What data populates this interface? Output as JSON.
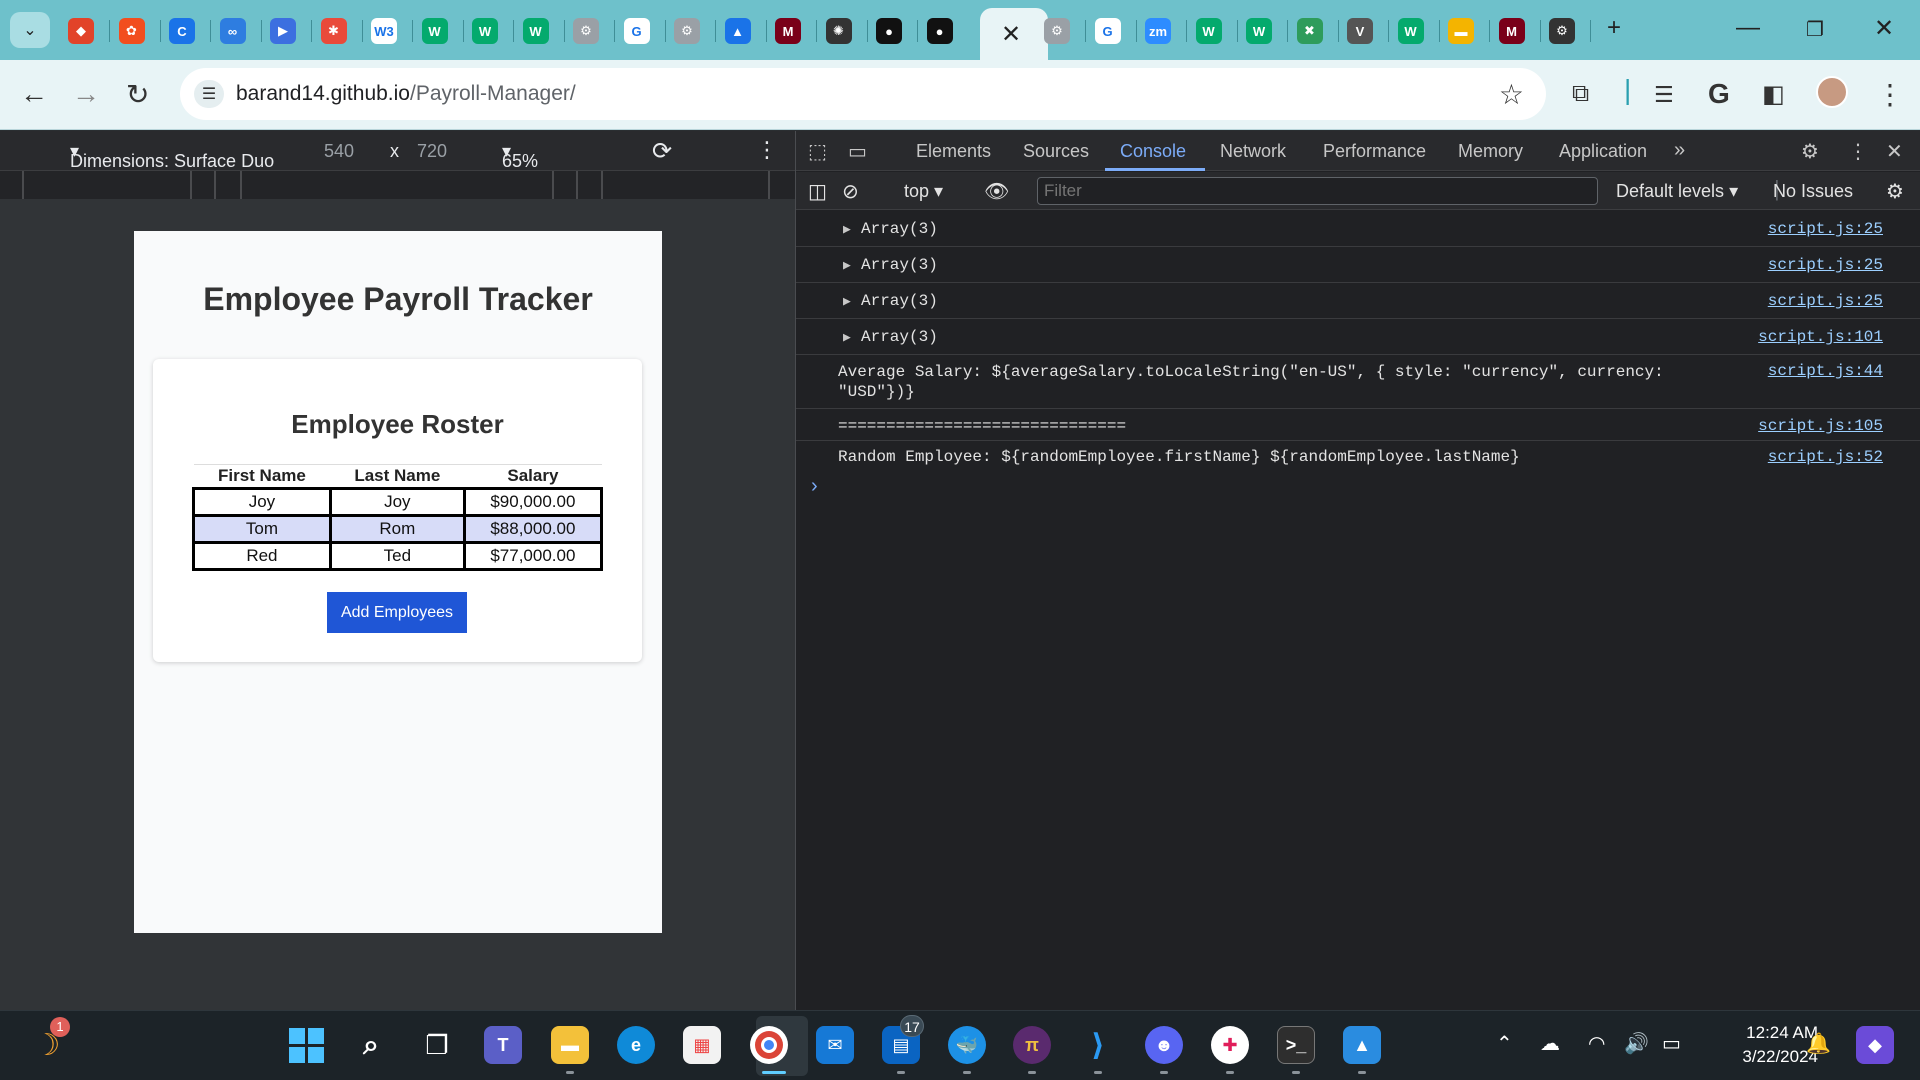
{
  "browser": {
    "tab_icons": [
      {
        "icon": "gitlab-icon",
        "color": "#e24329",
        "glyph": "◆"
      },
      {
        "icon": "figma-icon",
        "color": "#f24e1e",
        "glyph": "✿"
      },
      {
        "icon": "copyleaks-icon",
        "color": "#1a73e8",
        "glyph": "C"
      },
      {
        "icon": "loop-icon",
        "color": "#2e7de0",
        "glyph": "∞"
      },
      {
        "icon": "powerautomate-icon",
        "color": "#3c6fe0",
        "glyph": "▶"
      },
      {
        "icon": "asterisk-icon",
        "color": "#e94a3a",
        "glyph": "✱"
      },
      {
        "icon": "w3schools-icon",
        "color": "#ffffff",
        "glyph": "W3"
      },
      {
        "icon": "w-icon",
        "color": "#04aa6d",
        "glyph": "W"
      },
      {
        "icon": "w-icon",
        "color": "#04aa6d",
        "glyph": "W"
      },
      {
        "icon": "w-icon",
        "color": "#04aa6d",
        "glyph": "W"
      },
      {
        "icon": "extension-icon",
        "color": "#9aa0a6",
        "glyph": "⚙"
      },
      {
        "icon": "google-icon",
        "color": "#ffffff",
        "glyph": "G"
      },
      {
        "icon": "extension-icon",
        "color": "#9aa0a6",
        "glyph": "⚙"
      },
      {
        "icon": "azure-icon",
        "color": "#1a73e8",
        "glyph": "▲"
      },
      {
        "icon": "umn-icon",
        "color": "#7a0019",
        "glyph": "M"
      },
      {
        "icon": "openai-icon",
        "color": "#333333",
        "glyph": "✺"
      },
      {
        "icon": "github-icon",
        "color": "#111111",
        "glyph": "●"
      },
      {
        "icon": "github-icon",
        "color": "#111111",
        "glyph": "●"
      }
    ],
    "tab_icons_right": [
      {
        "icon": "extension-icon",
        "color": "#9aa0a6",
        "glyph": "⚙"
      },
      {
        "icon": "google-icon",
        "color": "#ffffff",
        "glyph": "G"
      },
      {
        "icon": "zoom-icon",
        "color": "#2d8cff",
        "glyph": "zm"
      },
      {
        "icon": "w-icon",
        "color": "#04aa6d",
        "glyph": "W"
      },
      {
        "icon": "w-icon",
        "color": "#04aa6d",
        "glyph": "W"
      },
      {
        "icon": "hexagon-icon",
        "color": "#2e9c5b",
        "glyph": "✖"
      },
      {
        "icon": "vaio-icon",
        "color": "#555555",
        "glyph": "V"
      },
      {
        "icon": "w-icon",
        "color": "#04aa6d",
        "glyph": "W"
      },
      {
        "icon": "slides-icon",
        "color": "#f4b400",
        "glyph": "▬"
      },
      {
        "icon": "umn-icon",
        "color": "#7a0019",
        "glyph": "M"
      },
      {
        "icon": "settings-icon",
        "color": "#333333",
        "glyph": "⚙"
      }
    ],
    "url_host": "barand14.github.io",
    "url_path": "/Payroll-Manager/"
  },
  "device_toolbar": {
    "dimensions_label": "Dimensions: Surface Duo",
    "width": "540",
    "times": "x",
    "height": "720",
    "zoom": "65%"
  },
  "page": {
    "title": "Employee Payroll Tracker",
    "roster_title": "Employee Roster",
    "columns": [
      "First Name",
      "Last Name",
      "Salary"
    ],
    "rows": [
      [
        "Joy",
        "Joy",
        "$90,000.00"
      ],
      [
        "Tom",
        "Rom",
        "$88,000.00"
      ],
      [
        "Red",
        "Ted",
        "$77,000.00"
      ]
    ],
    "add_button": "Add Employees"
  },
  "devtools": {
    "tabs": [
      "Elements",
      "Sources",
      "Console",
      "Network",
      "Performance",
      "Memory",
      "Application"
    ],
    "active_tab": "Console",
    "context": "top",
    "filter_placeholder": "Filter",
    "levels": "Default levels",
    "issues": "No Issues",
    "log": [
      {
        "expandable": true,
        "text": "Array(3)",
        "source": "script.js:25"
      },
      {
        "expandable": true,
        "text": "Array(3)",
        "source": "script.js:25"
      },
      {
        "expandable": true,
        "text": "Array(3)",
        "source": "script.js:25"
      },
      {
        "expandable": true,
        "text": "Array(3)",
        "source": "script.js:101"
      },
      {
        "expandable": false,
        "text": "Average Salary: ${averageSalary.toLocaleString(\"en-US\", { style: \"currency\", currency:\n\"USD\"})}",
        "source": "script.js:44"
      },
      {
        "expandable": false,
        "text": "==============================",
        "source": "script.js:105"
      },
      {
        "expandable": false,
        "text": "Random Employee: ${randomEmployee.firstName} ${randomEmployee.lastName}",
        "source": "script.js:52"
      }
    ]
  },
  "taskbar": {
    "notification_badge": "1",
    "mail_badge": "17",
    "time": "12:24 AM",
    "date": "3/22/2024"
  }
}
